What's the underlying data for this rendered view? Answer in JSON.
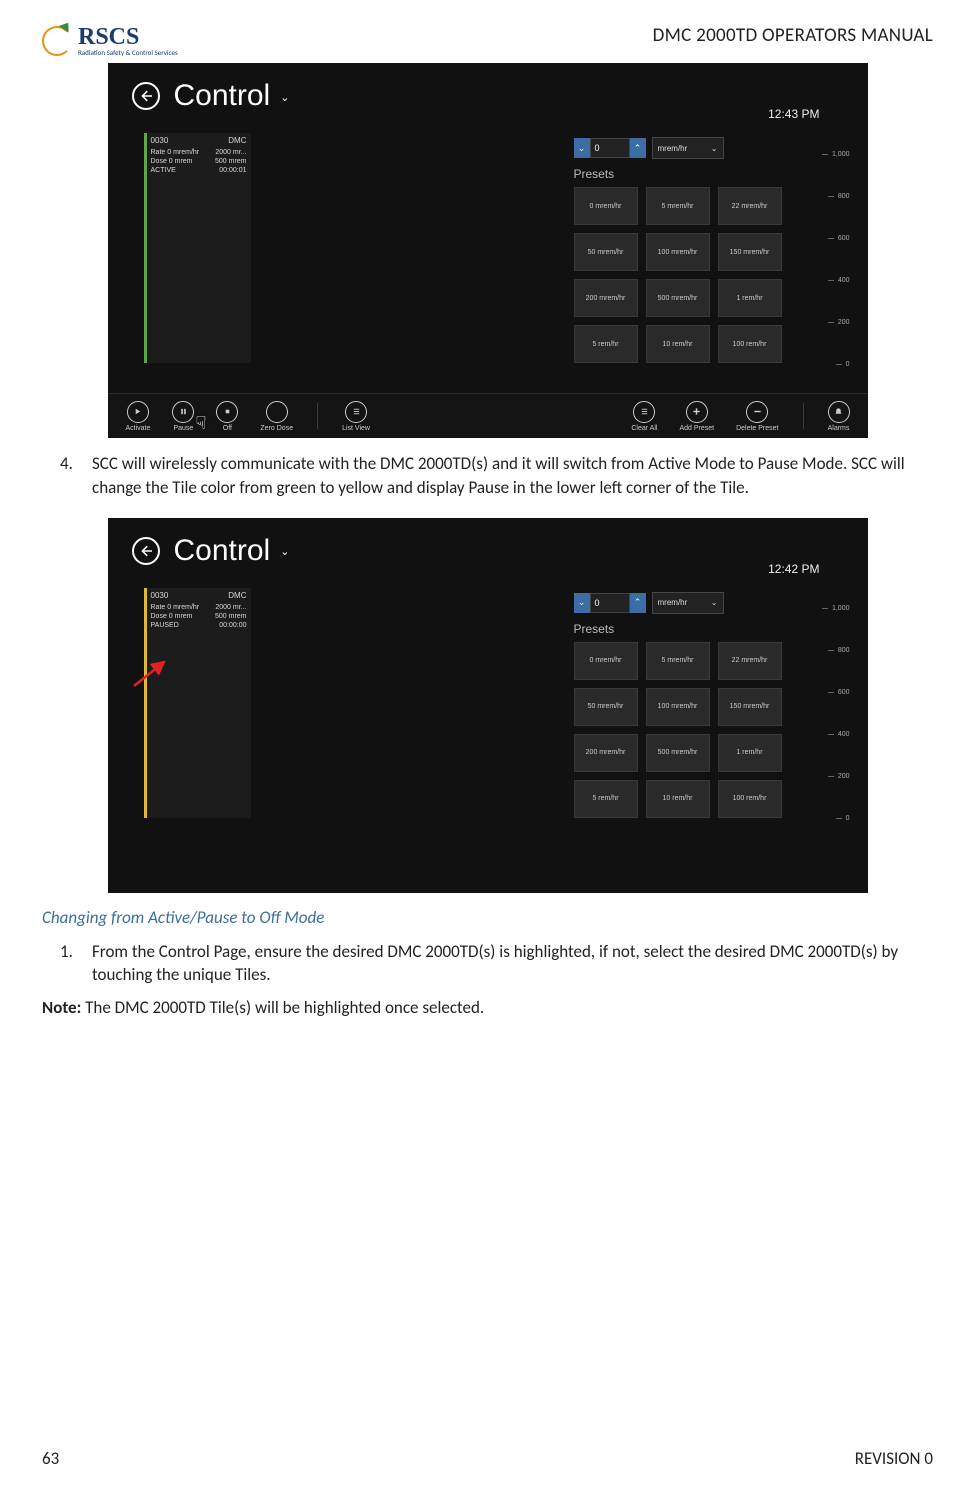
{
  "header": {
    "logo_main": "RSCS",
    "logo_sub": "Radiation Safety & Control Services",
    "doc_title": "DMC 2000TD OPERATORS MANUAL"
  },
  "footer": {
    "page_num": "63",
    "revision": "REVISION 0"
  },
  "step4": {
    "num": "4.",
    "text": "SCC will wirelessly communicate with the DMC 2000TD(s) and it will switch from Active Mode to Pause Mode. SCC will change the Tile color from green to yellow and display Pause in the lower left corner of the Tile."
  },
  "section2_heading": "Changing from Active/Pause to Off Mode",
  "step1b": {
    "num": "1.",
    "text": "From the Control Page, ensure the desired DMC 2000TD(s) is highlighted, if not, select the desired DMC 2000TD(s) by touching the unique Tiles."
  },
  "note": {
    "label": "Note:",
    "text": " The DMC 2000TD Tile(s) will be highlighted once selected."
  },
  "shot": {
    "title": "Control",
    "clock1": "12:43 PM",
    "clock2": "12:42 PM",
    "tile_id": "0030",
    "tile_model": "DMC",
    "tile_rate_l": "Rate 0 mrem/hr",
    "tile_rate_r": "2000 mr...",
    "tile_dose_l": "Dose 0 mrem",
    "tile_dose_r": "500 mrem",
    "tile_state_active": "ACTIVE",
    "tile_state_paused": "PAUSED",
    "tile_timer": "00:00:01",
    "tile_timer2": "00:00:00",
    "spin_value": "0",
    "unit": "mrem/hr",
    "presets_label": "Presets",
    "presets": [
      "0 mrem/hr",
      "5 mrem/hr",
      "22 mrem/hr",
      "50 mrem/hr",
      "100 mrem/hr",
      "150 mrem/hr",
      "200 mrem/hr",
      "500 mrem/hr",
      "1 rem/hr",
      "5 rem/hr",
      "10 rem/hr",
      "100 rem/hr"
    ],
    "scale": [
      "1,000",
      "800",
      "600",
      "400",
      "200",
      "0"
    ],
    "bottom": {
      "activate": "Activate",
      "pause": "Pause",
      "off": "Off",
      "zero": "Zero Dose",
      "list": "List View",
      "clear": "Clear All",
      "add": "Add Preset",
      "delete": "Delete Preset",
      "alarms": "Alarms"
    }
  }
}
